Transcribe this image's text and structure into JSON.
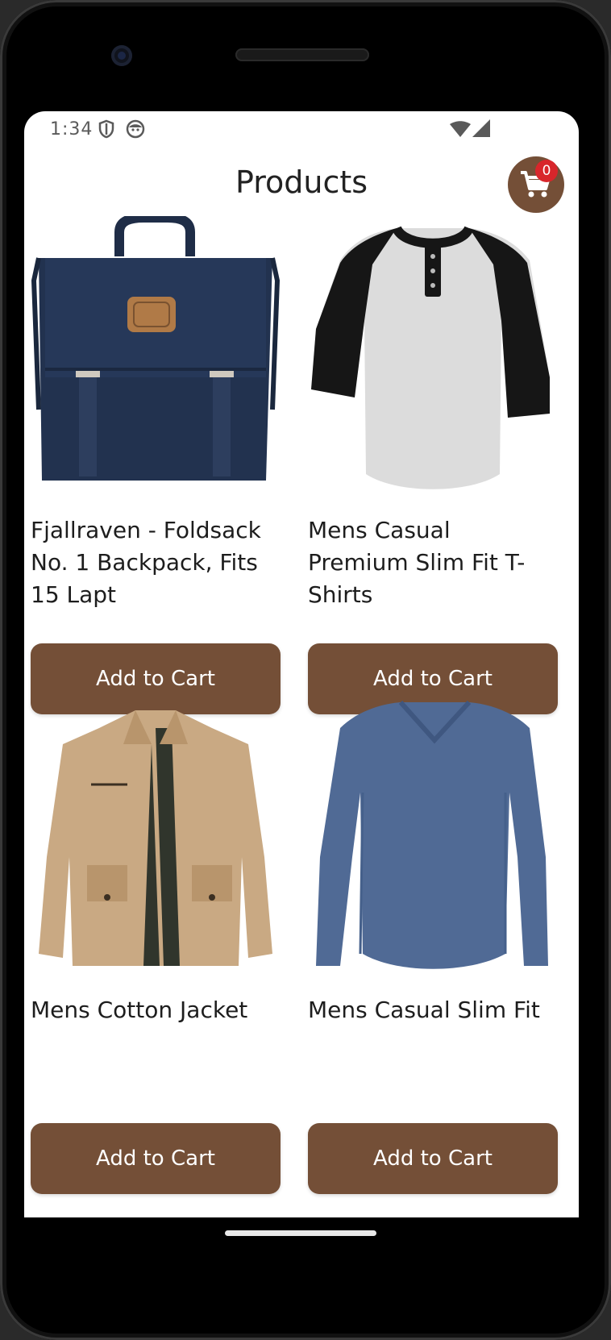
{
  "status_bar": {
    "time": "1:34",
    "icons": [
      "shield-icon",
      "face-icon",
      "wifi-icon",
      "signal-icon"
    ]
  },
  "header": {
    "title": "Products",
    "cart_count": "0",
    "cart_icon": "shopping-cart-icon"
  },
  "products": [
    {
      "title": "Fjallraven - Foldsack No. 1 Backpack, Fits 15 Lapt",
      "button": "Add to Cart",
      "image": "backpack-navy"
    },
    {
      "title": "Mens Casual Premium Slim Fit T-Shirts",
      "button": "Add to Cart",
      "image": "raglan-tshirt"
    },
    {
      "title": "Mens Cotton Jacket",
      "button": "Add to Cart",
      "image": "cotton-jacket-khaki"
    },
    {
      "title": "Mens Casual Slim Fit",
      "button": "Add to Cart",
      "image": "longsleeve-blue"
    }
  ],
  "colors": {
    "accent": "#744f37",
    "badge": "#d8262b",
    "background": "#ffffff"
  }
}
